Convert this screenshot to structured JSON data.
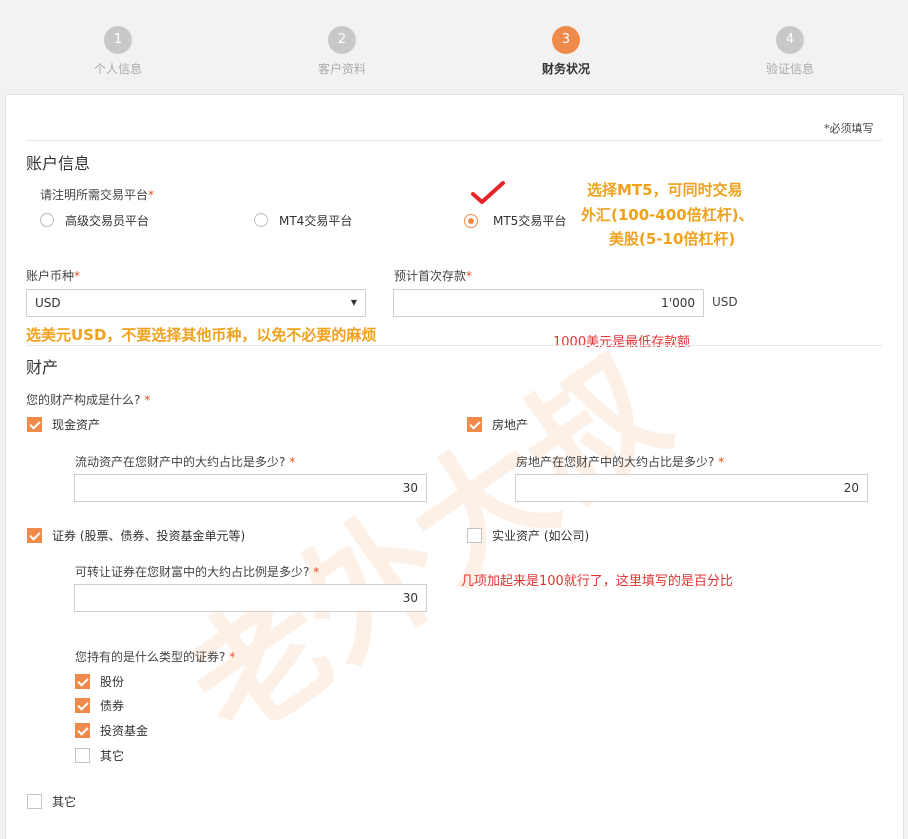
{
  "steps": [
    {
      "num": "1",
      "label": "个人信息"
    },
    {
      "num": "2",
      "label": "客户资料"
    },
    {
      "num": "3",
      "label": "财务状况"
    },
    {
      "num": "4",
      "label": "验证信息"
    }
  ],
  "required_note": "*必须填写",
  "account": {
    "title": "账户信息",
    "platform_label": "请注明所需交易平台",
    "platforms": [
      "高级交易员平台",
      "MT4交易平台",
      "MT5交易平台"
    ],
    "currency_label": "账户币种",
    "currency_value": "USD",
    "deposit_label": "预计首次存款",
    "deposit_value": "1'000",
    "deposit_unit": "USD"
  },
  "assets": {
    "title": "财产",
    "composition_label": "您的财产构成是什么?",
    "cash_label": "现金资产",
    "realestate_label": "房地产",
    "liquid_q": "流动资产在您财产中的大约占比是多少?",
    "liquid_value": "30",
    "realestate_q": "房地产在您财产中的大约占比是多少?",
    "realestate_value": "20",
    "securities_label": "证券 (股票、债券、投资基金单元等)",
    "business_label": "实业资产 (如公司)",
    "securities_q": "可转让证券在您财富中的大约占比例是多少?",
    "securities_value": "30",
    "sec_types_q": "您持有的是什么类型的证券?",
    "sec_types": [
      "股份",
      "债券",
      "投资基金",
      "其它"
    ],
    "other_label": "其它"
  },
  "annotations": {
    "mt5_note_1": "选择MT5，可同时交易",
    "mt5_note_2": "外汇(100-400倍杠杆)、",
    "mt5_note_3": "美股(5-10倍杠杆)",
    "currency_note": "选美元USD，不要选择其他币种，以免不必要的麻烦",
    "deposit_note": "1000美元是最低存款额",
    "percent_note": "几项加起来是100就行了，这里填写的是百分比"
  },
  "watermark": "老外大叔",
  "colors": {
    "accent": "#f08a4b",
    "annotation_orange": "#f0a21d",
    "annotation_red": "#e53333"
  }
}
